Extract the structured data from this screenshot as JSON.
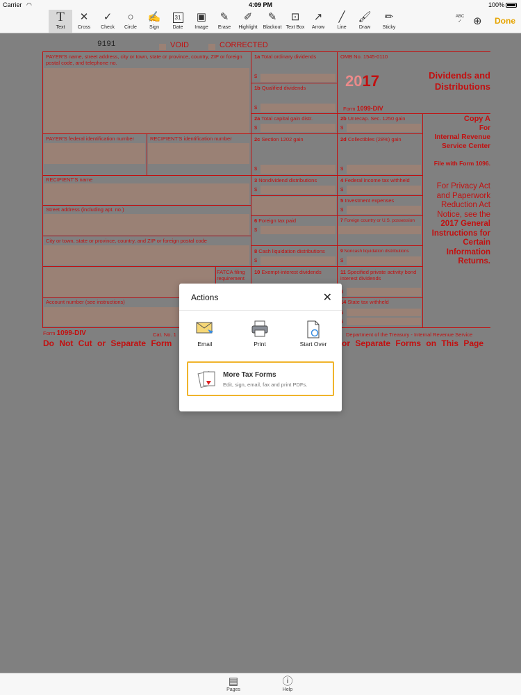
{
  "status": {
    "carrier": "Carrier",
    "time": "4:09 PM",
    "battery": "100%"
  },
  "toolbar": {
    "tools": [
      "Text",
      "Cross",
      "Check",
      "Circle",
      "Sign",
      "Date",
      "Image",
      "Erase",
      "Highlight",
      "Blackout",
      "Text Box",
      "Arrow",
      "Line",
      "Draw",
      "Sticky"
    ],
    "abc": "ABC",
    "done": "Done",
    "date_num": "31"
  },
  "form": {
    "code": "9191",
    "void": "VOID",
    "corrected": "CORRECTED",
    "payer_name": "PAYER'S name, street address, city or town, state or province, country, ZIP or foreign postal code, and telephone no.",
    "payer_tin": "PAYER'S federal identification number",
    "recipient_tin": "RECIPIENT'S identification number",
    "recipient_name": "RECIPIENT'S name",
    "street": "Street address (including apt. no.)",
    "city": "City or town, state or province, country, and ZIP or foreign postal code",
    "fatca": "FATCA filing requirement",
    "account": "Account number (see instructions)",
    "b1a_num": "1a",
    "b1a": "Total ordinary dividends",
    "b1b_num": "1b",
    "b1b": "Qualified dividends",
    "b2a_num": "2a",
    "b2a": "Total capital gain distr.",
    "b2b_num": "2b",
    "b2b": "Unrecap. Sec. 1250 gain",
    "b2c_num": "2c",
    "b2c": "Section 1202 gain",
    "b2d_num": "2d",
    "b2d": "Collectibles (28%) gain",
    "b3_num": "3",
    "b3": "Nondividend distributions",
    "b4_num": "4",
    "b4": "Federal income tax withheld",
    "b5_num": "5",
    "b5": "Investment expenses",
    "b6_num": "6",
    "b6": "Foreign tax paid",
    "b7_num": "7",
    "b7": "Foreign country or U.S. possession",
    "b8_num": "8",
    "b8": "Cash liquidation distributions",
    "b9_num": "9",
    "b9": "Noncash liquidation distributions",
    "b10_num": "10",
    "b10": "Exempt-interest dividends",
    "b11_num": "11",
    "b11": "Specified private activity bond interest dividends",
    "b14_num": "14",
    "b14": "State tax withheld",
    "dollar": "$",
    "omb": "OMB No. 1545-0110",
    "year_prefix": "20",
    "year_suffix": "17",
    "form_word": "Form",
    "form_num": "1099-DIV",
    "heading": "Dividends and Distributions",
    "copy": "Copy A",
    "for": "For",
    "irs1": "Internal Revenue",
    "irs2": "Service Center",
    "file_with": "File with Form 1096.",
    "privacy1": "For Privacy Act",
    "privacy2": "and Paperwork",
    "privacy3": "Reduction Act",
    "privacy4": "Notice, see the",
    "privacy5": "2017 General",
    "privacy6": "Instructions for",
    "privacy7": "Certain",
    "privacy8": "Information",
    "privacy9": "Returns.",
    "footer_form": "Form",
    "footer_num": "1099-DIV",
    "cat": "Cat. No. 1",
    "dept": "Department of the Treasury - Internal Revenue Service",
    "dnc_left": "Do Not Cut or Separate Form",
    "dnc_right": "or Separate Forms on This Page"
  },
  "dialog": {
    "title": "Actions",
    "actions": [
      "Email",
      "Print",
      "Start Over"
    ],
    "promo_title": "More Tax Forms",
    "promo_sub": "Edit, sign, email, fax and print PDFs."
  },
  "bottom": {
    "pages": "Pages",
    "help": "Help"
  },
  "colors": {
    "form_red": "#c21010",
    "done": "#e6a400",
    "promo_border": "#f0b42c"
  }
}
